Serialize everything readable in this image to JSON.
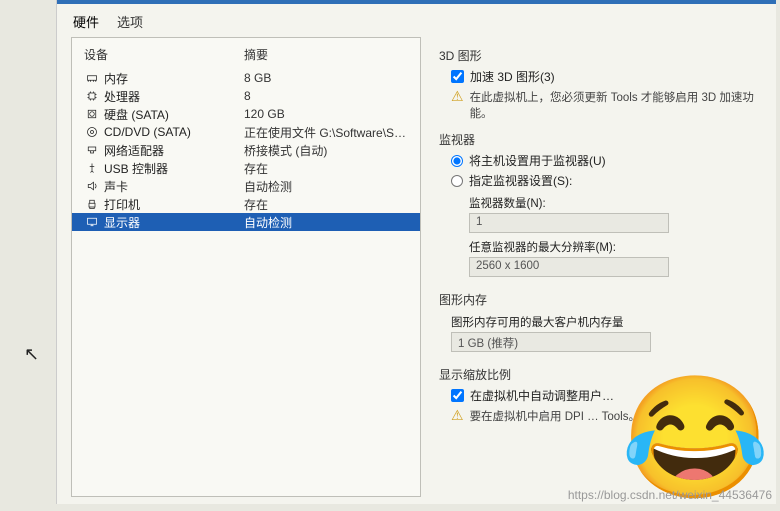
{
  "tabs": {
    "hardware": "硬件",
    "options": "选项"
  },
  "columns": {
    "device": "设备",
    "summary": "摘要"
  },
  "devices": [
    {
      "icon": "memory-icon",
      "label": "内存",
      "value": "8 GB"
    },
    {
      "icon": "cpu-icon",
      "label": "处理器",
      "value": "8"
    },
    {
      "icon": "disk-icon",
      "label": "硬盘 (SATA)",
      "value": "120 GB"
    },
    {
      "icon": "cd-icon",
      "label": "CD/DVD (SATA)",
      "value": "正在使用文件 G:\\Software\\Sys..."
    },
    {
      "icon": "nic-icon",
      "label": "网络适配器",
      "value": "桥接模式 (自动)"
    },
    {
      "icon": "usb-icon",
      "label": "USB 控制器",
      "value": "存在"
    },
    {
      "icon": "sound-icon",
      "label": "声卡",
      "value": "自动检测"
    },
    {
      "icon": "printer-icon",
      "label": "打印机",
      "value": "存在"
    },
    {
      "icon": "display-icon",
      "label": "显示器",
      "value": "自动检测",
      "selected": true
    }
  ],
  "threeD": {
    "title": "3D 图形",
    "accelLabel": "加速 3D 图形(3)",
    "accelChecked": true,
    "warnText": "在此虚拟机上，您必须更新 Tools 才能够启用 3D 加速功能。"
  },
  "monitor": {
    "title": "监视器",
    "useHost": "将主机设置用于监视器(U)",
    "specify": "指定监视器设置(S):",
    "selected": "useHost",
    "countLabel": "监视器数量(N):",
    "countValue": "1",
    "maxResLabel": "任意监视器的最大分辨率(M):",
    "maxResValue": "2560 x 1600"
  },
  "gmem": {
    "title": "图形内存",
    "hint": "图形内存可用的最大客户机内存量",
    "value": "1 GB (推荐)"
  },
  "scaling": {
    "title": "显示缩放比例",
    "autoFit": "在虚拟机中自动调整用户…",
    "autoFitChecked": true,
    "dpiText": "要在虚拟机中启用 DPI … Tools。"
  },
  "watermark": "https://blog.csdn.net/weixin_44536476"
}
